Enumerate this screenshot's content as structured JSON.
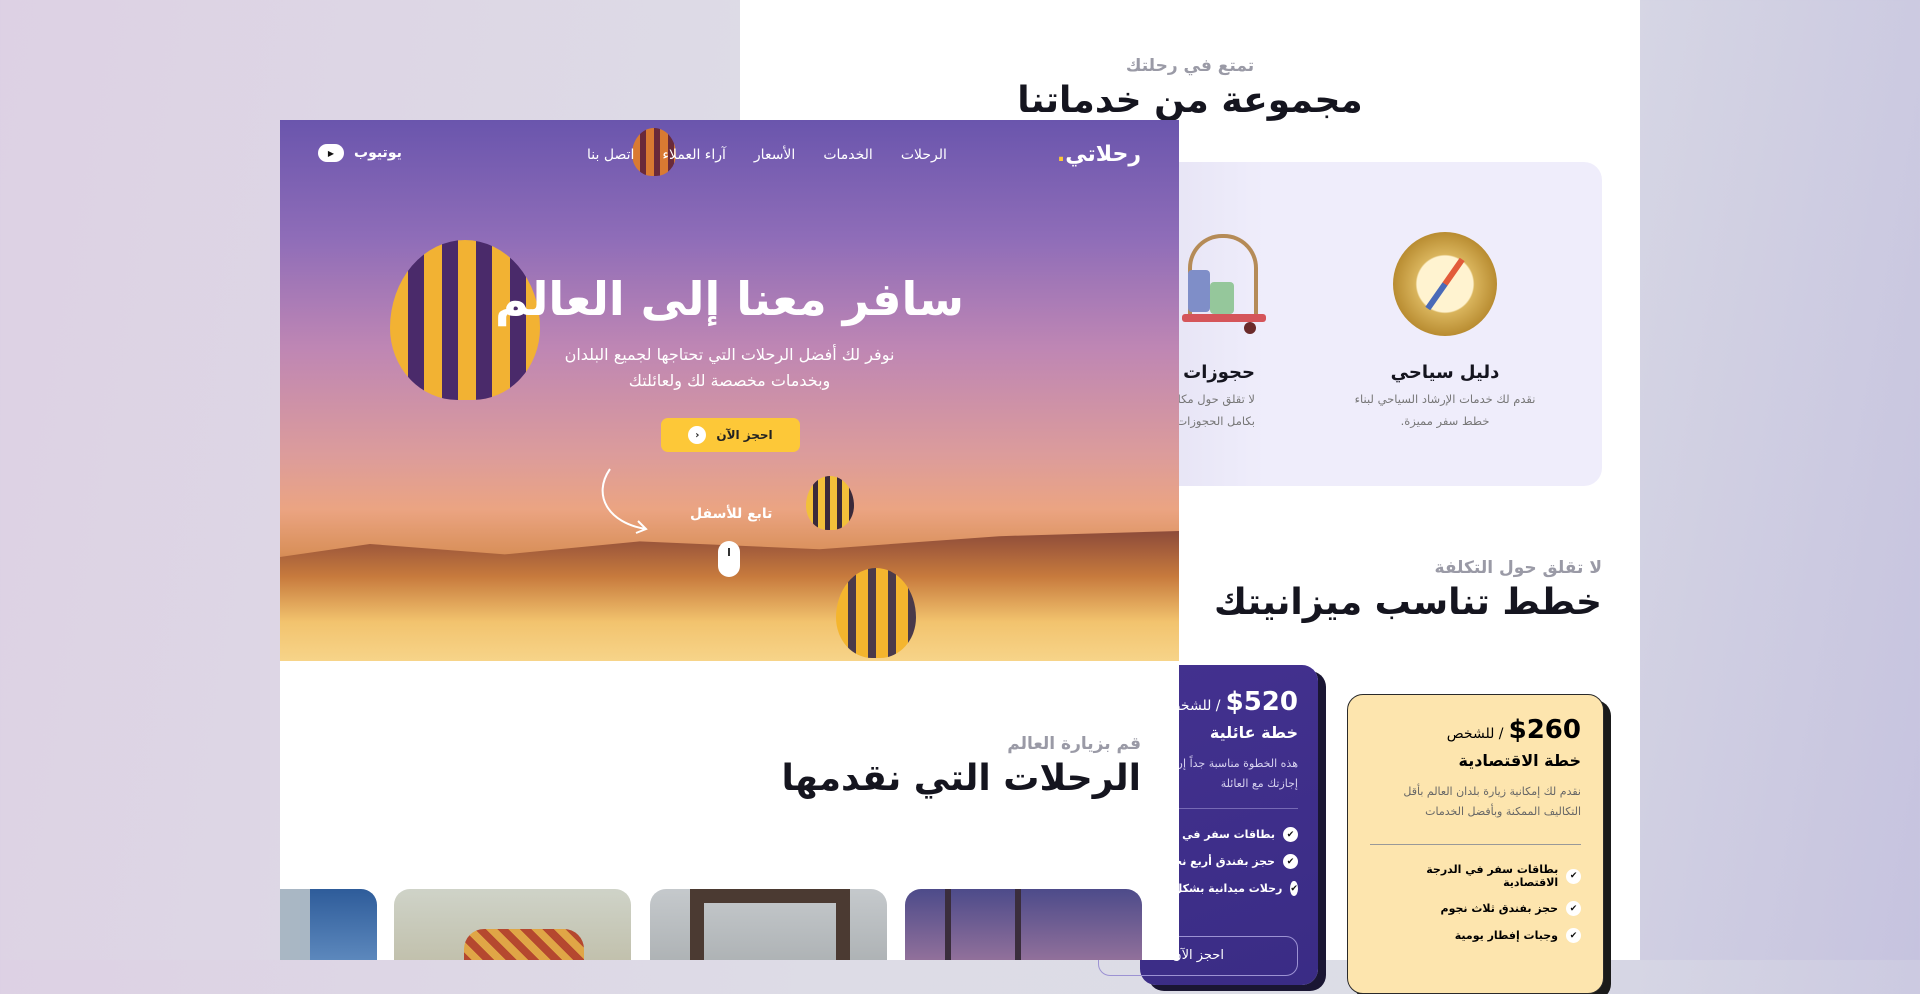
{
  "services_page": {
    "subtitle": "تمتع في رحلتك",
    "title": "مجموعة من خدماتنا",
    "services": [
      {
        "icon": "compass-icon",
        "title": "دليل سياحي",
        "desc_line1": "نقدم لك خدمات الإرشاد السياحي لبناء",
        "desc_line2": "خطط سفر مميزة."
      },
      {
        "icon": "luggage-trolley-icon",
        "title": "حجوزات ف",
        "desc_line1": "لا تقلق حول مكان إقا",
        "desc_line2": "بكامل الحجوزات"
      }
    ],
    "pricing_subtitle": "لا تقلق حول التكلفة",
    "pricing_title": "خطط تناسب ميزانيتك",
    "plans": [
      {
        "price": "$260",
        "per": "/ للشخص",
        "name": "خطة الاقتصادية",
        "desc": "نقدم لك إمكانية زيارة بلدان العالم بأقل التكاليف الممكنة وبأفضل الخدمات",
        "features": [
          "بطاقات سفر في الدرجة الاقتصادية",
          "حجز بفندق ثلاث نجوم",
          "وجبات إفطار يومية"
        ]
      },
      {
        "price": "$520",
        "per": "/ للشخص",
        "name": "خطة عائلية",
        "desc": "هذه الخطوة مناسبة جداً إن أردت قضاء إجازتك مع العائلة",
        "features": [
          "بطاقات سفر في الدرجة",
          "حجز بفندق أربع نجوم",
          "رحلات ميدانية بشكل يومي"
        ],
        "button": "احجز الآن"
      }
    ]
  },
  "landing": {
    "logo": "رحلاتي",
    "logo_dot": ".",
    "nav": [
      "الرحلات",
      "الخدمات",
      "الأسعار",
      "آراء العملاء",
      "اتصل بنا"
    ],
    "youtube_label": "يوتيوب",
    "hero_title": "سافر معنا إلى العالم",
    "hero_desc_line1": "نوفر لك أفضل الرحلات التي تحتاجها لجميع البلدان",
    "hero_desc_line2": "وبخدمات مخصصة لك ولعائلتك",
    "cta": "احجز الآن",
    "scroll_label": "تابع للأسفل",
    "trips_subtitle": "قم بزيارة العالم",
    "trips_title": "الرحلات التي نقدمها"
  },
  "colors": {
    "accent": "#fdc838",
    "purple": "#3e2f8a",
    "cream": "#fde5ae"
  }
}
